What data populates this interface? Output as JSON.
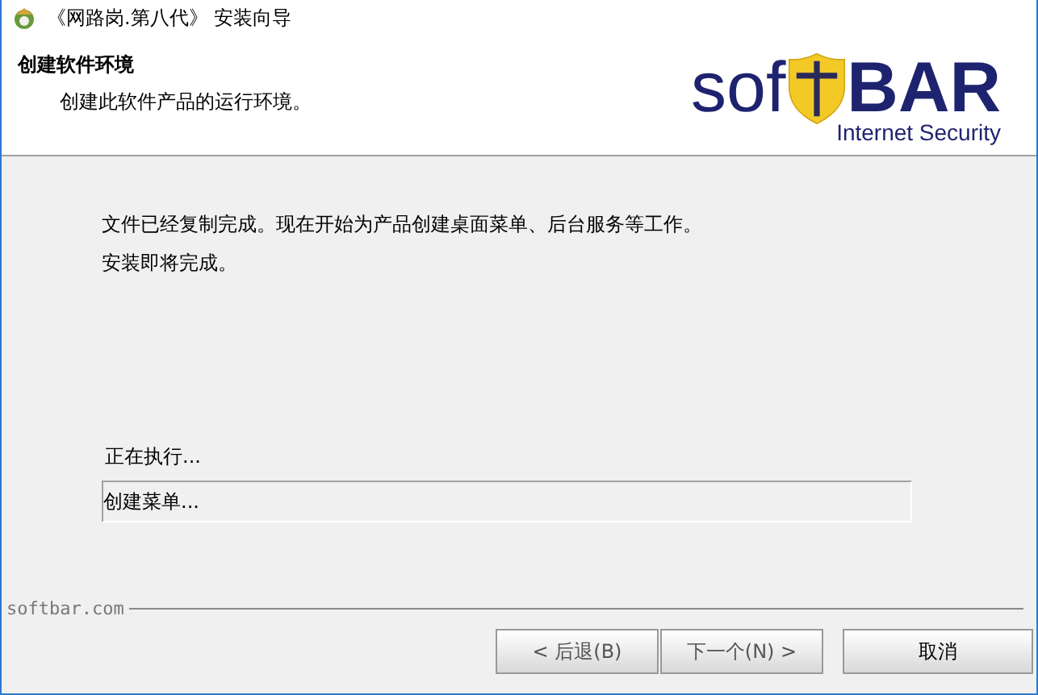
{
  "window": {
    "title": "《网路岗.第八代》 安装向导"
  },
  "header": {
    "title": "创建软件环境",
    "subtitle": "创建此软件产品的运行环境。",
    "logo": {
      "left": "sof",
      "right": "BAR",
      "tagline": "Internet Security"
    }
  },
  "body": {
    "paragraphs": [
      "文件已经复制完成。现在开始为产品创建桌面菜单、后台服务等工作。",
      "安装即将完成。"
    ],
    "status_label": "正在执行...",
    "status_value": "创建菜单..."
  },
  "footer": {
    "brand": "softbar.com"
  },
  "buttons": [
    {
      "label": "< 后退(B)",
      "disabled": true
    },
    {
      "label": "下一个(N) >",
      "disabled": true
    },
    {
      "label": "取消",
      "disabled": false
    }
  ]
}
